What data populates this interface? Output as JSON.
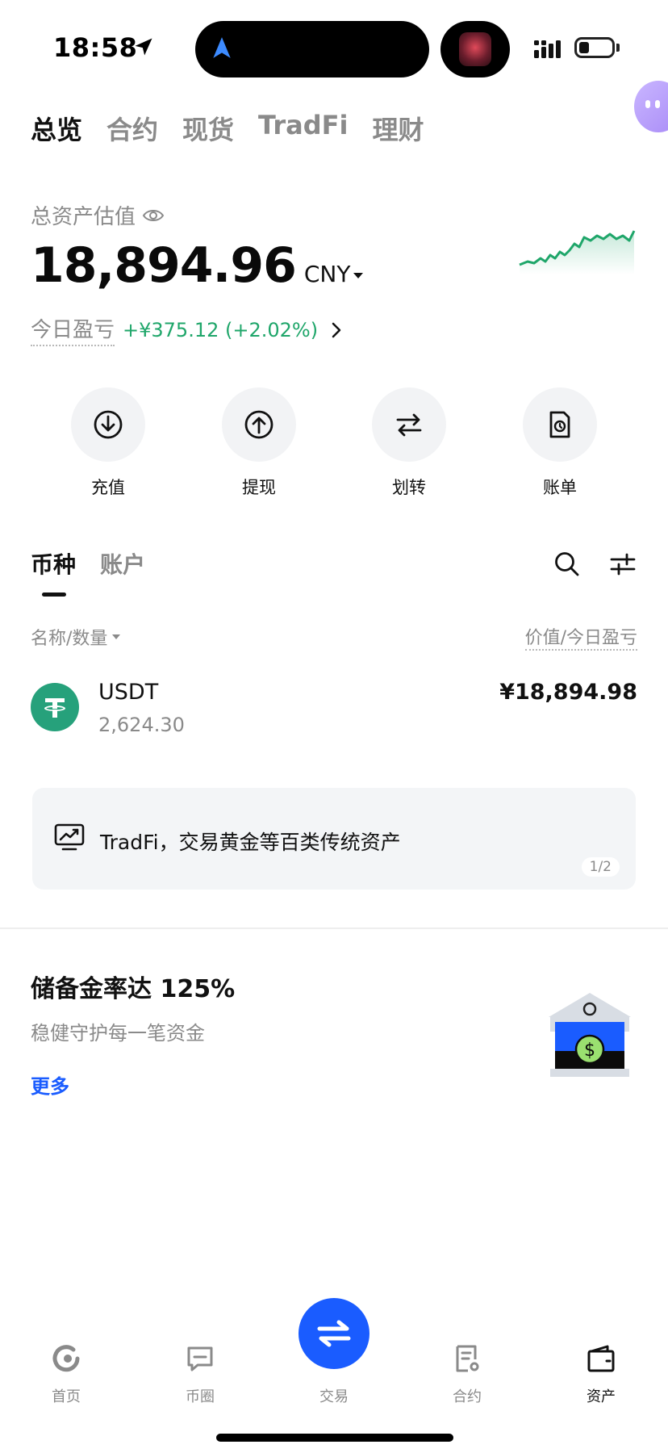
{
  "status_bar": {
    "time": "18:58"
  },
  "top_tabs": [
    {
      "label": "总览",
      "active": true
    },
    {
      "label": "合约",
      "active": false
    },
    {
      "label": "现货",
      "active": false
    },
    {
      "label": "TradFi",
      "active": false
    },
    {
      "label": "理财",
      "active": false
    }
  ],
  "summary": {
    "label": "总资产估值",
    "balance": "18,894.96",
    "currency": "CNY",
    "pnl_label": "今日盈亏",
    "pnl_value": "+¥375.12 (+2.02%)",
    "pnl_color": "#1fa66a"
  },
  "actions": [
    {
      "label": "充值",
      "icon": "deposit-icon"
    },
    {
      "label": "提现",
      "icon": "withdraw-icon"
    },
    {
      "label": "划转",
      "icon": "transfer-icon"
    },
    {
      "label": "账单",
      "icon": "bill-icon"
    }
  ],
  "section_tabs": [
    {
      "label": "币种",
      "active": true
    },
    {
      "label": "账户",
      "active": false
    }
  ],
  "list_header": {
    "left": "名称/数量",
    "right": "价值/今日盈亏"
  },
  "coins": [
    {
      "name": "USDT",
      "amount": "2,624.30",
      "value": "¥18,894.98",
      "logo_color": "#26a17b"
    }
  ],
  "banner": {
    "text": "TradFi，交易黄金等百类传统资产",
    "pager": "1/2"
  },
  "reserve": {
    "title": "储备金率达 125%",
    "subtitle": "稳健守护每一笔资金",
    "more": "更多",
    "accent": "#1a5cff"
  },
  "bottom_nav": [
    {
      "label": "首页",
      "icon": "home-icon",
      "active": false
    },
    {
      "label": "币圈",
      "icon": "community-icon",
      "active": false
    },
    {
      "label": "交易",
      "icon": "trade-icon",
      "active": false
    },
    {
      "label": "合约",
      "icon": "contract-icon",
      "active": false
    },
    {
      "label": "资产",
      "icon": "wallet-icon",
      "active": true
    }
  ]
}
